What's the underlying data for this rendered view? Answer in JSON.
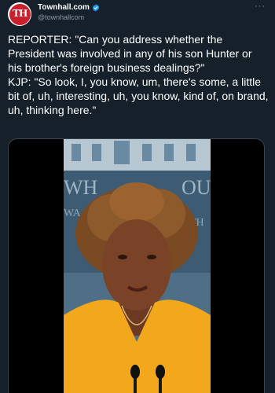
{
  "tweet": {
    "author_name": "Townhall.com",
    "handle": "@townhallcom",
    "avatar_text": "TH",
    "more_label": "···",
    "paragraphs": [
      "REPORTER: \"Can you address whether the President was involved in any of his son Hunter or his brother's foreign business dealings?\"",
      "KJP: \"So look, I, you know, um, there's some, a little bit of, uh, interesting, uh, you know, kind of, on brand, uh, thinking here.\""
    ]
  },
  "media": {
    "backdrop_text_1": "WH",
    "backdrop_text_2": "OU",
    "backdrop_text_3": "WA",
    "backdrop_text_4": "TH"
  },
  "colors": {
    "background": "#15202b",
    "brand_red": "#c8202c",
    "verified_blue": "#1d9bf0",
    "muted": "#8b98a5"
  }
}
